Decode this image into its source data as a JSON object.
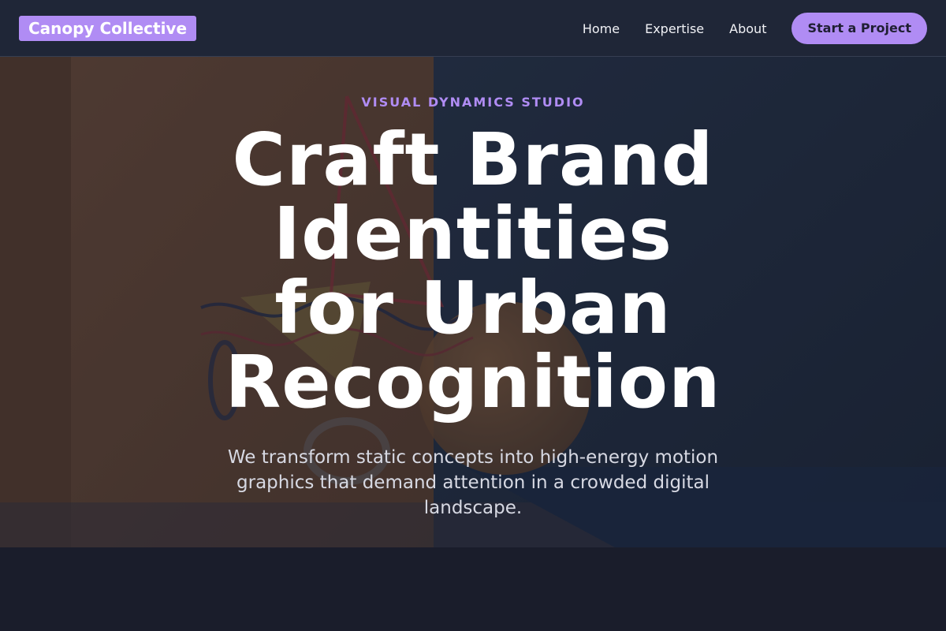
{
  "header": {
    "logo": "Canopy Collective",
    "nav": [
      {
        "label": "Home"
      },
      {
        "label": "Expertise"
      },
      {
        "label": "About"
      }
    ],
    "cta_label": "Start a Project"
  },
  "hero": {
    "eyebrow": "VISUAL DYNAMICS STUDIO",
    "headline_lines": [
      "Craft Brand",
      "Identities",
      "for Urban",
      "Recognition"
    ],
    "subtext": "We transform static concepts into high-energy motion graphics that demand attention in a crowded digital landscape.",
    "background_colors": {
      "warm": "#6b4a35",
      "cool": "#243044",
      "floor": "#1e2a40"
    }
  },
  "colors": {
    "accent": "#b08cf4",
    "header_bg": "#1f2637",
    "page_bg": "#1a1d2b"
  }
}
